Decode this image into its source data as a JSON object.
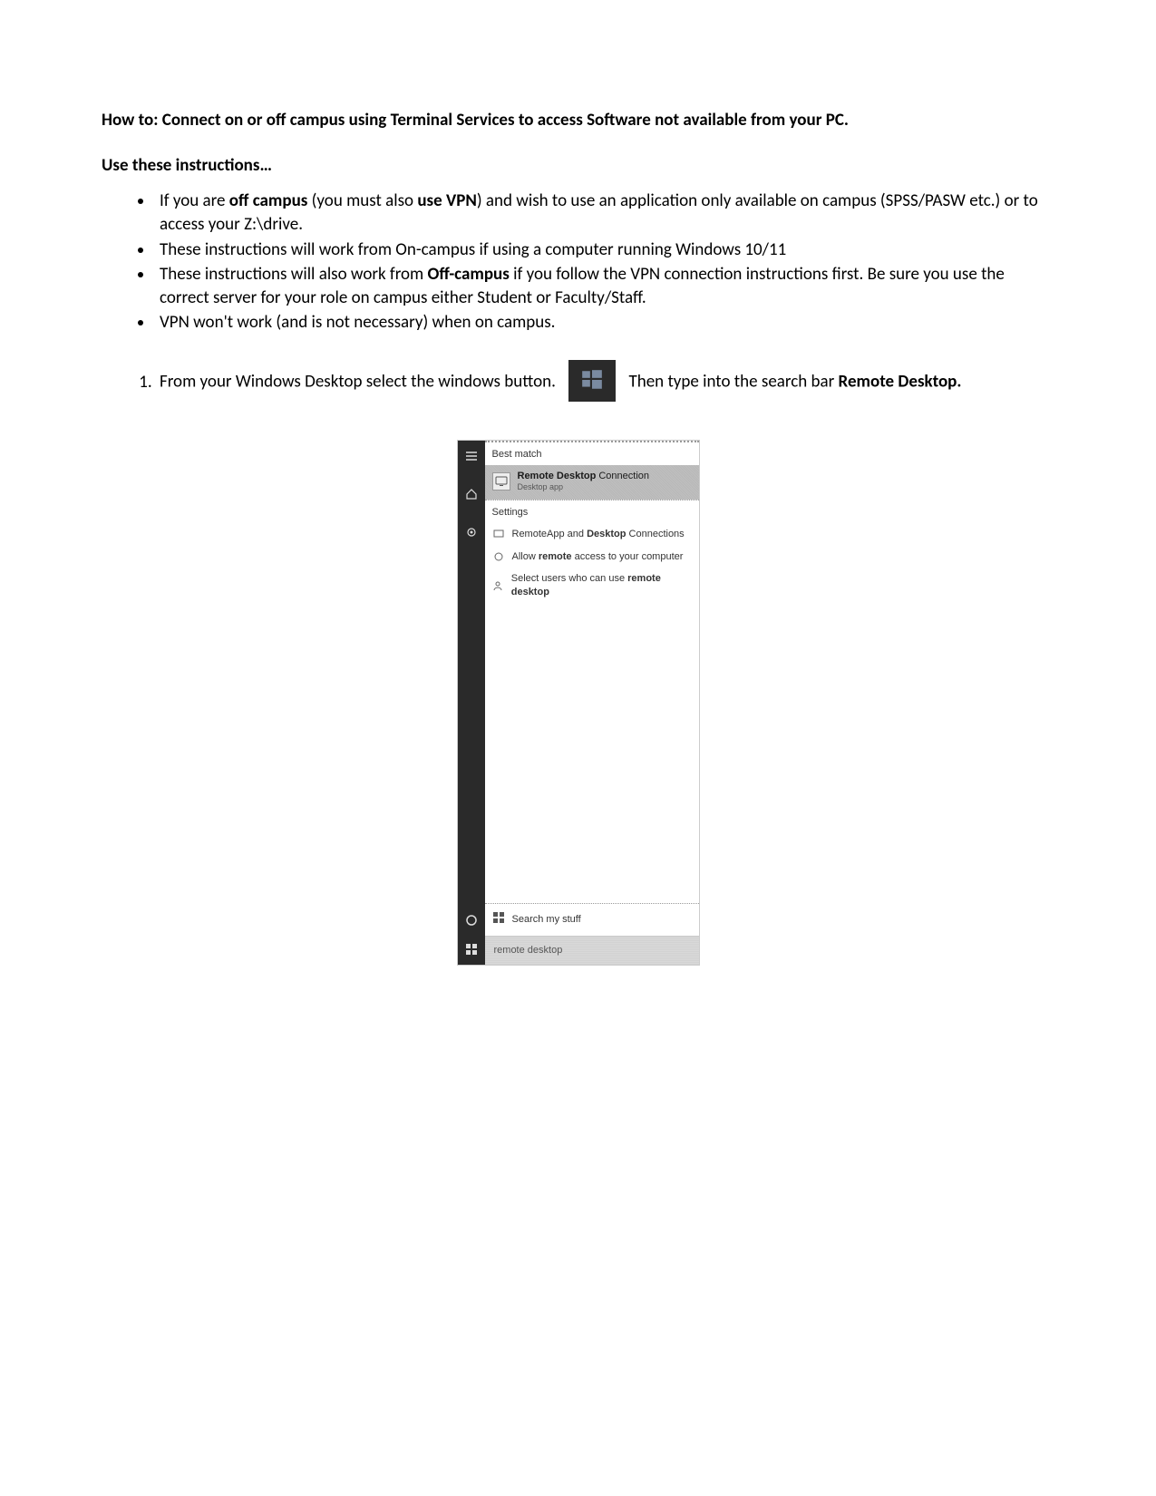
{
  "heading": "How to: Connect on or off campus using Terminal Services to access Software not available from your PC.",
  "subheading": "Use these instructions…",
  "bullets": {
    "b1_pre": "If you are ",
    "b1_bold1": "off campus",
    "b1_mid": " (you must also ",
    "b1_bold2": "use VPN",
    "b1_post": ") and wish to use an application only available on campus (SPSS/PASW etc.) or to access your Z:\\drive.",
    "b2": "These instructions will work from On-campus if using a computer running Windows 10/11",
    "b3_pre": "These instructions will also work from ",
    "b3_bold": "Off-campus",
    "b3_post": " if you follow the VPN connection instructions first. Be sure you use the correct server for your role on campus either Student or Faculty/Staff.",
    "b4": "VPN won't work (and is not necessary) when on campus."
  },
  "step1": {
    "pre": "From your Windows Desktop select the windows button.",
    "post": "Then type into the search bar ",
    "bold": "Remote Desktop."
  },
  "startmenu": {
    "bestmatch_label": "Best match",
    "bestmatch_title": "Remote Desktop Connection",
    "bestmatch_sub": "Desktop app",
    "settings_label": "Settings",
    "settings_items": [
      "RemoteApp and Desktop Connections",
      "Allow remote access to your computer",
      "Select users who can use remote desktop"
    ],
    "search_my_stuff": "Search my stuff",
    "search_value": "remote desktop"
  }
}
